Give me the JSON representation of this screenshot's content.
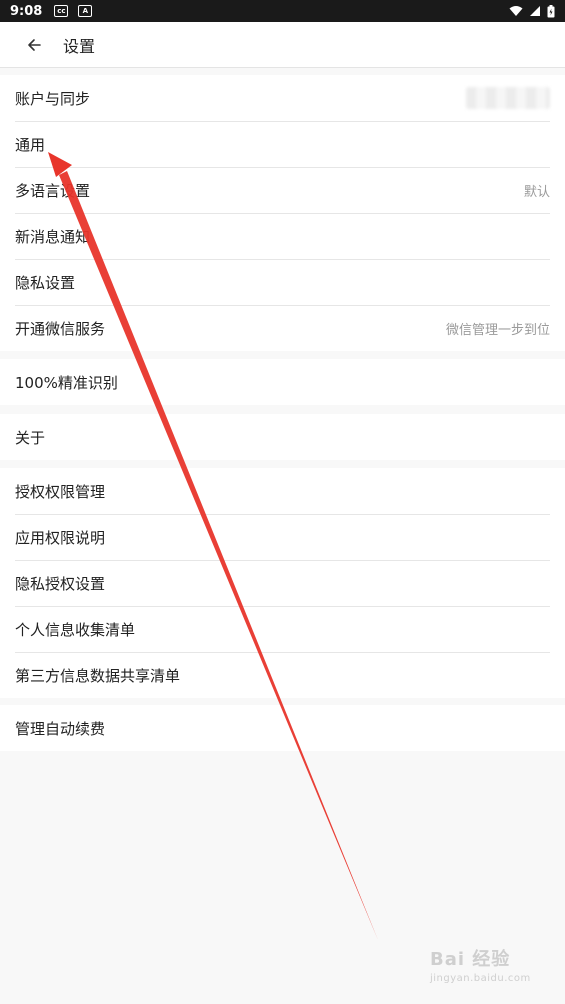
{
  "status_bar": {
    "time": "9:08",
    "icon_cc": "cc",
    "icon_a": "A"
  },
  "header": {
    "title": "设置"
  },
  "sections": [
    {
      "items": [
        {
          "label": "账户与同步",
          "value": ""
        },
        {
          "label": "通用",
          "value": ""
        },
        {
          "label": "多语言设置",
          "value": "默认"
        },
        {
          "label": "新消息通知",
          "value": ""
        },
        {
          "label": "隐私设置",
          "value": ""
        },
        {
          "label": "开通微信服务",
          "value": "微信管理一步到位"
        }
      ]
    },
    {
      "items": [
        {
          "label": "100%精准识别",
          "value": ""
        }
      ]
    },
    {
      "items": [
        {
          "label": "关于",
          "value": ""
        }
      ]
    },
    {
      "items": [
        {
          "label": "授权权限管理",
          "value": ""
        },
        {
          "label": "应用权限说明",
          "value": ""
        },
        {
          "label": "隐私授权设置",
          "value": ""
        },
        {
          "label": "个人信息收集清单",
          "value": ""
        },
        {
          "label": "第三方信息数据共享清单",
          "value": ""
        }
      ]
    },
    {
      "items": [
        {
          "label": "管理自动续费",
          "value": ""
        }
      ]
    }
  ],
  "watermark": {
    "brand": "Bai 经验",
    "url": "jingyan.baidu.com"
  },
  "colors": {
    "annotation_arrow": "#e8352b",
    "background": "#f8f8f8"
  }
}
